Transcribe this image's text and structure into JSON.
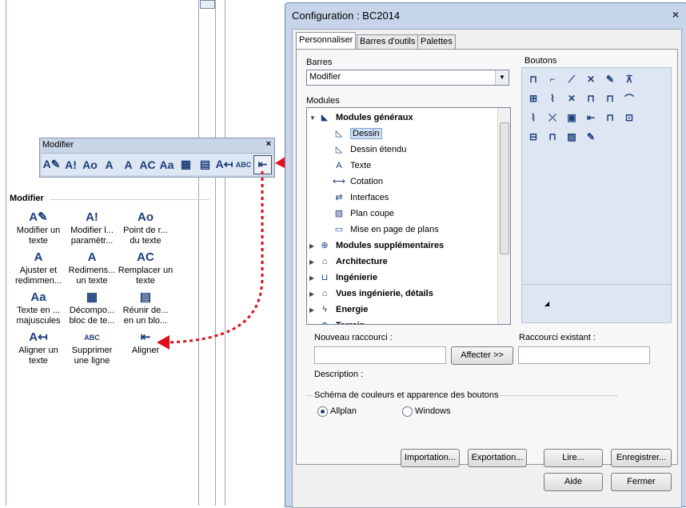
{
  "toolbar": {
    "title": "Modifier",
    "close": "×",
    "buttons": [
      {
        "glyph": "A✎",
        "icon": "modify-text-icon"
      },
      {
        "glyph": "A!",
        "icon": "modify-text-params-icon"
      },
      {
        "glyph": "Ao",
        "icon": "text-point-icon"
      },
      {
        "glyph": "A",
        "icon": "adjust-text-icon"
      },
      {
        "glyph": "A",
        "icon": "resize-text-icon"
      },
      {
        "glyph": "AC",
        "icon": "replace-text-icon"
      },
      {
        "glyph": "Aa",
        "icon": "uppercase-text-icon"
      },
      {
        "glyph": "▦",
        "icon": "decompose-text-icon"
      },
      {
        "glyph": "▤",
        "icon": "merge-text-icon"
      },
      {
        "glyph": "A↤",
        "icon": "align-text-icon"
      },
      {
        "glyph": "ABC",
        "icon": "delete-line-icon"
      },
      {
        "glyph": "⇤",
        "icon": "align-icon"
      }
    ]
  },
  "palette": {
    "header": "Modifier",
    "items": [
      {
        "label": "Modifier un texte",
        "glyph": "A✎"
      },
      {
        "label": "Modifier l... paramètr...",
        "glyph": "A!"
      },
      {
        "label": "Point de r... du texte",
        "glyph": "Ao"
      },
      {
        "label": "Ajuster et redimmen...",
        "glyph": "A"
      },
      {
        "label": "Redimens... un texte",
        "glyph": "A"
      },
      {
        "label": "Remplacer un texte",
        "glyph": "AC"
      },
      {
        "label": "Texte en ... majuscules",
        "glyph": "Aa"
      },
      {
        "label": "Décompo... bloc de te...",
        "glyph": "▦"
      },
      {
        "label": "Réunir de... en un blo...",
        "glyph": "▤"
      },
      {
        "label": "Aligner un texte",
        "glyph": "A↤"
      },
      {
        "label": "Supprimer une ligne",
        "glyph": "ABC"
      },
      {
        "label": "Aligner",
        "glyph": "⇤"
      }
    ]
  },
  "dialog": {
    "title": "Configuration :  BC2014",
    "close": "×",
    "tabs": [
      "Personnaliser",
      "Barres d'outils",
      "Palettes"
    ],
    "barres_label": "Barres",
    "barres_value": "Modifier",
    "modules_label": "Modules",
    "boutons_label": "Boutons",
    "tree": [
      {
        "label": "Modules généraux",
        "bold": true,
        "glyph": "◣"
      },
      {
        "label": "Dessin",
        "bold": false,
        "glyph": "◺",
        "selected": true
      },
      {
        "label": "Dessin étendu",
        "bold": false,
        "glyph": "◺"
      },
      {
        "label": "Texte",
        "bold": false,
        "glyph": "A"
      },
      {
        "label": "Cotation",
        "bold": false,
        "glyph": "⟷"
      },
      {
        "label": "Interfaces",
        "bold": false,
        "glyph": "⇄"
      },
      {
        "label": "Plan coupe",
        "bold": false,
        "glyph": "▨"
      },
      {
        "label": "Mise en page de plans",
        "bold": false,
        "glyph": "▭"
      },
      {
        "label": "Modules supplémentaires",
        "bold": true,
        "glyph": "⊕"
      },
      {
        "label": "Architecture",
        "bold": true,
        "glyph": "⌂"
      },
      {
        "label": "Ingénierie",
        "bold": true,
        "glyph": "⊔"
      },
      {
        "label": "Vues ingénierie, détails",
        "bold": true,
        "glyph": "⌂"
      },
      {
        "label": "Energie",
        "bold": true,
        "glyph": "ϟ"
      },
      {
        "label": "Terrain",
        "bold": true,
        "glyph": "⊕"
      }
    ],
    "button_glyphs": [
      "⊓",
      "⌐",
      "⟋",
      "✕",
      "✎",
      "⊼",
      "⊞",
      "⌇",
      "✕",
      "⊓",
      "⊓",
      "⌒",
      "⌇",
      "⤫",
      "▣",
      "⇤",
      "⊓",
      "⊡",
      "⊟",
      "⊓",
      "▨",
      "✎"
    ],
    "nouveau_raccourci_label": "Nouveau raccourci :",
    "affecter_button": "Affecter >>",
    "raccourci_existant_label": "Raccourci existant :",
    "description_label": "Description :",
    "schema_label": "Schéma de couleurs et apparence des boutons",
    "radio_allplan": "Allplan",
    "radio_windows": "Windows",
    "buttons": {
      "importation": "Importation...",
      "exportation": "Exportation...",
      "lire": "Lire...",
      "enregistrer": "Enregistrer...",
      "aide": "Aide",
      "fermer": "Fermer"
    }
  },
  "colors": {
    "arrow": "#e0101a",
    "dialog_frame": "#c6d5ea",
    "icon_blue": "#1d3e7a"
  }
}
